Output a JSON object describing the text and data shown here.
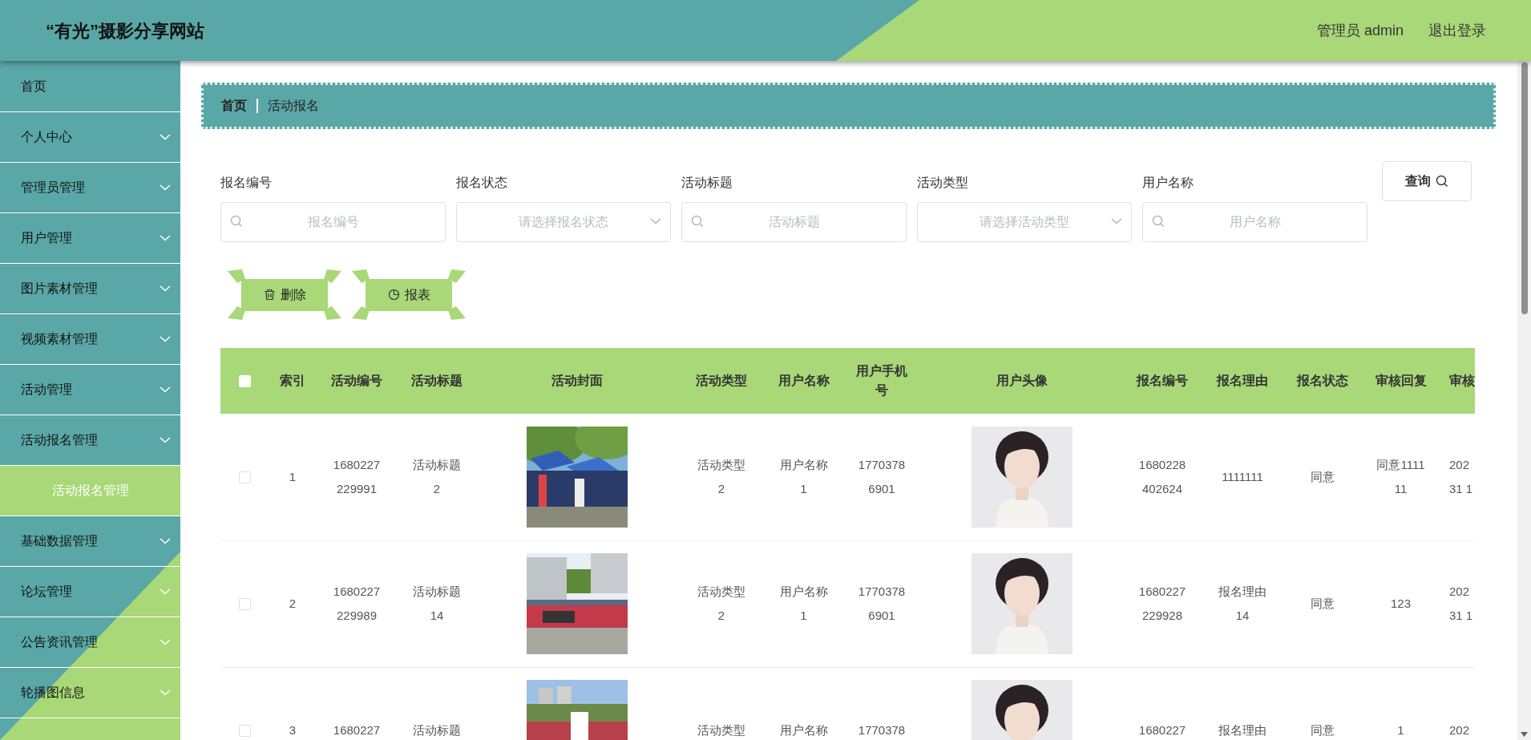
{
  "header": {
    "site_title": "“有光”摄影分享网站",
    "user": "管理员 admin",
    "logout": "退出登录"
  },
  "sidebar": {
    "items": [
      {
        "label": "首页",
        "kind": "link"
      },
      {
        "label": "个人中心",
        "kind": "menu"
      },
      {
        "label": "管理员管理",
        "kind": "menu"
      },
      {
        "label": "用户管理",
        "kind": "menu"
      },
      {
        "label": "图片素材管理",
        "kind": "menu"
      },
      {
        "label": "视频素材管理",
        "kind": "menu"
      },
      {
        "label": "活动管理",
        "kind": "menu"
      },
      {
        "label": "活动报名管理",
        "kind": "menu",
        "children": [
          {
            "label": "活动报名管理",
            "selected": true
          }
        ]
      },
      {
        "label": "基础数据管理",
        "kind": "menu"
      },
      {
        "label": "论坛管理",
        "kind": "menu"
      },
      {
        "label": "公告资讯管理",
        "kind": "menu"
      },
      {
        "label": "轮播图信息",
        "kind": "menu"
      }
    ]
  },
  "breadcrumb": [
    {
      "label": "首页",
      "current": false
    },
    {
      "label": "活动报名",
      "current": true
    }
  ],
  "filters": [
    {
      "label": "报名编号",
      "kind": "text",
      "placeholder": "报名编号"
    },
    {
      "label": "报名状态",
      "kind": "select",
      "placeholder": "请选择报名状态"
    },
    {
      "label": "活动标题",
      "kind": "text",
      "placeholder": "活动标题"
    },
    {
      "label": "活动类型",
      "kind": "select",
      "placeholder": "请选择活动类型"
    },
    {
      "label": "用户名称",
      "kind": "text",
      "placeholder": "用户名称"
    }
  ],
  "search_button": "查询",
  "actions": [
    {
      "label": "删除",
      "kind": "delete"
    },
    {
      "label": "报表",
      "kind": "report"
    }
  ],
  "table": {
    "select_all_checked": false,
    "columns": [
      {
        "kind": "check"
      },
      {
        "label": "索引",
        "kind": "text"
      },
      {
        "label": "活动编号",
        "kind": "text"
      },
      {
        "label": "活动标题",
        "kind": "text"
      },
      {
        "label": "活动封面"
      },
      {
        "label": "活动类型",
        "kind": "text"
      },
      {
        "label": "用户名称",
        "kind": "text"
      },
      {
        "label": "用户手机号",
        "kind": "text"
      },
      {
        "label": "用户头像"
      },
      {
        "label": "报名编号",
        "kind": "text"
      },
      {
        "label": "报名理由",
        "kind": "text"
      },
      {
        "label": "报名状态",
        "kind": "text"
      },
      {
        "label": "审核回复",
        "kind": "text"
      },
      {
        "label": "审核",
        "kind": "text"
      }
    ],
    "rows": [
      {
        "checked": false,
        "cells": [
          "",
          "1",
          "1680227229991",
          "活动标题2",
          {
            "kind": "picture"
          },
          "活动类型2",
          "用户名称1",
          "17703786901",
          {
            "kind": "picture"
          },
          "1680228402624",
          "1111111",
          "同意",
          "同意111111",
          "202\n31 1"
        ]
      },
      {
        "checked": false,
        "cells": [
          "",
          "2",
          "1680227229989",
          "活动标题14",
          {
            "kind": "picture"
          },
          "活动类型2",
          "用户名称1",
          "17703786901",
          {
            "kind": "picture"
          },
          "1680227229928",
          "报名理由14",
          "同意",
          "123",
          "202\n31 1"
        ]
      },
      {
        "checked": false,
        "cells": [
          "",
          "3",
          "1680227",
          "活动标题",
          {
            "kind": "picture"
          },
          "活动类型",
          "用户名称",
          "1770378",
          {
            "kind": "picture"
          },
          "1680227",
          "报名理由",
          "同意",
          "1",
          "202"
        ]
      }
    ]
  }
}
